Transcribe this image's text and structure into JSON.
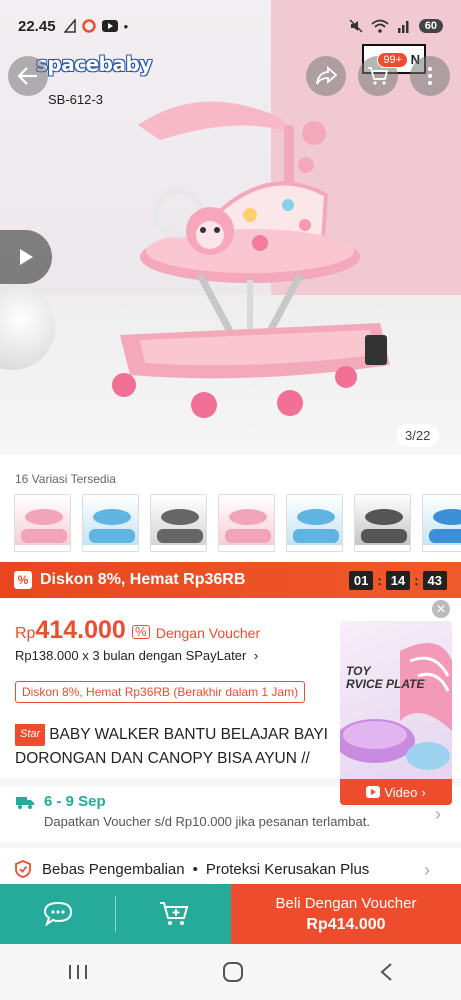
{
  "status": {
    "time": "22.45",
    "battery": "60"
  },
  "hero": {
    "brand": "spacebaby",
    "model": "SB-612-3",
    "counter": "3/22",
    "cart_badge": "99+",
    "corner_brand": "N"
  },
  "variants": {
    "label": "16 Variasi Tersedia",
    "colors": [
      "#f5c9d3",
      "#bde0f2",
      "#cfcfcf",
      "#f5c9d3",
      "#bde0f2",
      "#bdbdbd",
      "#bde0f2"
    ],
    "accents": [
      "#f2a4b8",
      "#5fb4e2",
      "#666666",
      "#f2a4b8",
      "#5fb4e2",
      "#555555",
      "#3b8fd6"
    ]
  },
  "flash": {
    "text": "Diskon 8%, Hemat Rp36RB",
    "hours": "01",
    "minutes": "14",
    "seconds": "43"
  },
  "price": {
    "currency": "Rp",
    "value": "414.000",
    "voucher_text": "Dengan Voucher",
    "installment": "Rp138.000 x 3 bulan dengan SPayLater",
    "promo_tag": "Diskon 8%, Hemat Rp36RB (Berakhir dalam 1 Jam)"
  },
  "product": {
    "star_badge": "Star",
    "title": "BABY WALKER BANTU BELAJAR BAYI DORONGAN DAN CANOPY BISA AYUN // BABY"
  },
  "shipping": {
    "date": "6 - 9 Sep",
    "note": "Dapatkan Voucher s/d Rp10.000 jika pesanan terlambat."
  },
  "protection": {
    "label_1": "Bebas Pengembalian",
    "label_2": "Proteksi Kerusakan Plus"
  },
  "float_video": {
    "toy_line1": "TOY",
    "toy_line2": "RVICE PLATE",
    "button": "Video"
  },
  "bottom": {
    "buy_line1": "Beli Dengan Voucher",
    "buy_line2": "Rp414.000"
  },
  "colors": {
    "accent": "#ee4d2d",
    "teal": "#26aa99"
  }
}
